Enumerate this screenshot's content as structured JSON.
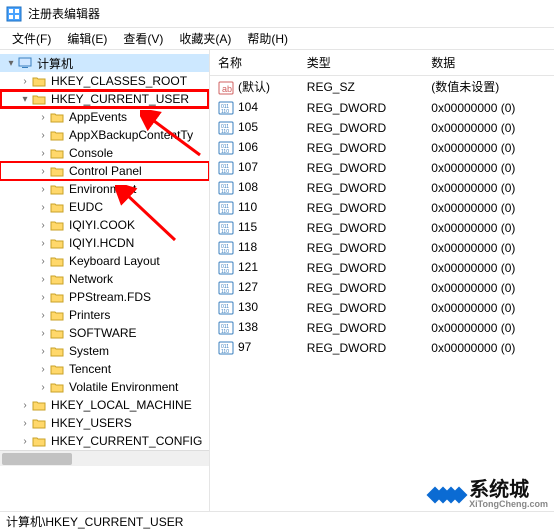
{
  "window": {
    "title": "注册表编辑器"
  },
  "menu": {
    "file": "文件(F)",
    "edit": "编辑(E)",
    "view": "查看(V)",
    "favorites": "收藏夹(A)",
    "help": "帮助(H)"
  },
  "tree": {
    "root": "计算机",
    "hives": {
      "hkcr": "HKEY_CLASSES_ROOT",
      "hkcu": "HKEY_CURRENT_USER",
      "hklm": "HKEY_LOCAL_MACHINE",
      "hku": "HKEY_USERS",
      "hkcc": "HKEY_CURRENT_CONFIG"
    },
    "hkcu_children": [
      "AppEvents",
      "AppXBackupContentTy",
      "Console",
      "Control Panel",
      "Environment",
      "EUDC",
      "IQIYI.COOK",
      "IQIYI.HCDN",
      "Keyboard Layout",
      "Network",
      "PPStream.FDS",
      "Printers",
      "SOFTWARE",
      "System",
      "Tencent",
      "Volatile Environment"
    ]
  },
  "list": {
    "headers": {
      "name": "名称",
      "type": "类型",
      "data": "数据"
    },
    "default_row": {
      "name": "(默认)",
      "type": "REG_SZ",
      "data": "(数值未设置)"
    },
    "rows": [
      {
        "name": "104",
        "type": "REG_DWORD",
        "data": "0x00000000 (0)"
      },
      {
        "name": "105",
        "type": "REG_DWORD",
        "data": "0x00000000 (0)"
      },
      {
        "name": "106",
        "type": "REG_DWORD",
        "data": "0x00000000 (0)"
      },
      {
        "name": "107",
        "type": "REG_DWORD",
        "data": "0x00000000 (0)"
      },
      {
        "name": "108",
        "type": "REG_DWORD",
        "data": "0x00000000 (0)"
      },
      {
        "name": "110",
        "type": "REG_DWORD",
        "data": "0x00000000 (0)"
      },
      {
        "name": "115",
        "type": "REG_DWORD",
        "data": "0x00000000 (0)"
      },
      {
        "name": "118",
        "type": "REG_DWORD",
        "data": "0x00000000 (0)"
      },
      {
        "name": "121",
        "type": "REG_DWORD",
        "data": "0x00000000 (0)"
      },
      {
        "name": "127",
        "type": "REG_DWORD",
        "data": "0x00000000 (0)"
      },
      {
        "name": "130",
        "type": "REG_DWORD",
        "data": "0x00000000 (0)"
      },
      {
        "name": "138",
        "type": "REG_DWORD",
        "data": "0x00000000 (0)"
      },
      {
        "name": "97",
        "type": "REG_DWORD",
        "data": "0x00000000 (0)"
      }
    ]
  },
  "statusbar": {
    "path": "计算机\\HKEY_CURRENT_USER"
  },
  "watermark": {
    "text": "系统城",
    "url": "XiTongCheng.com"
  },
  "highlights": {
    "hkcu": true,
    "control_panel": true
  }
}
